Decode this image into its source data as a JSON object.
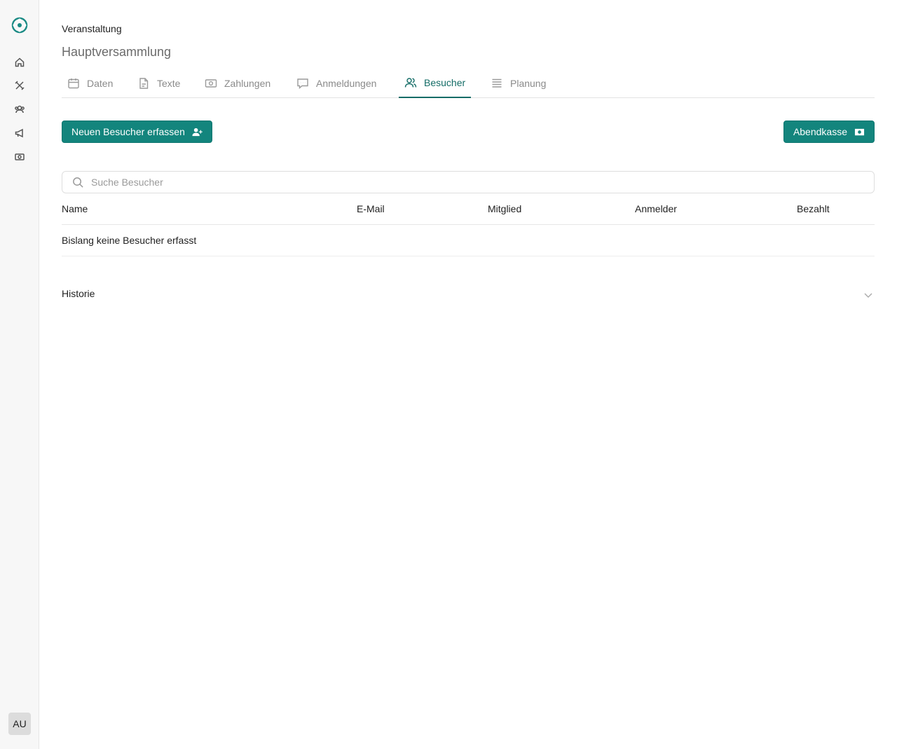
{
  "user": {
    "initials": "AU"
  },
  "header": {
    "section_label": "Veranstaltung",
    "title": "Hauptversammlung"
  },
  "tabs": [
    {
      "label": "Daten",
      "icon": "calendar-icon"
    },
    {
      "label": "Texte",
      "icon": "document-icon"
    },
    {
      "label": "Zahlungen",
      "icon": "banknote-icon"
    },
    {
      "label": "Anmeldungen",
      "icon": "chat-bubble-icon"
    },
    {
      "label": "Besucher",
      "icon": "users-icon",
      "active": true
    },
    {
      "label": "Planung",
      "icon": "list-icon"
    }
  ],
  "actions": {
    "new_visitor": "Neuen Besucher erfassen",
    "box_office": "Abendkasse"
  },
  "search": {
    "placeholder": "Suche Besucher"
  },
  "table": {
    "columns": [
      "Name",
      "E-Mail",
      "Mitglied",
      "Anmelder",
      "Bezahlt"
    ],
    "empty_text": "Bislang keine Besucher erfasst"
  },
  "history": {
    "label": "Historie"
  },
  "colors": {
    "accent": "#13857d",
    "active_tab": "#136c66"
  }
}
